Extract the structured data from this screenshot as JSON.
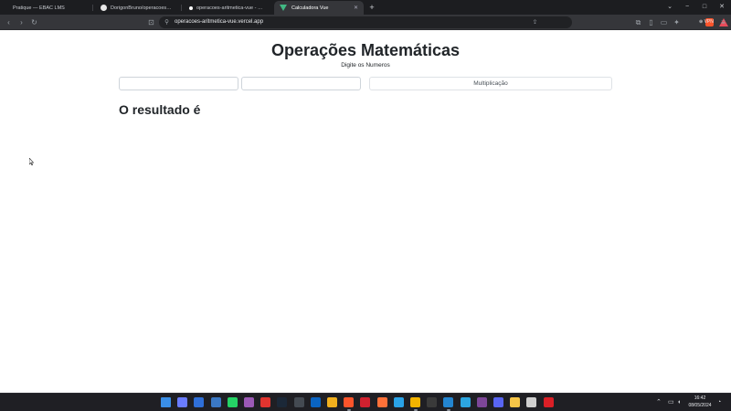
{
  "browser": {
    "tabs": [
      {
        "label": "Pratique — EBAC LMS",
        "icon": "ebac-favicon-icon"
      },
      {
        "label": "DorigonBruno/operacoes_aritmetica",
        "icon": "github-icon"
      },
      {
        "label": "operacoes-aritmetica-vue - Overview",
        "icon": "vercel-icon"
      },
      {
        "label": "Calculadora Vue",
        "icon": "vue-icon",
        "active": true
      }
    ],
    "new_tab": "+",
    "controls": {
      "minimize": "−",
      "maximize": "□",
      "close": "✕",
      "tab_list": "⌄"
    },
    "nav": {
      "back": "‹",
      "forward": "›",
      "reload": "↻",
      "bookmark": "⊡"
    },
    "url": "operacoes-aritmetica-vue.vercel.app",
    "vpn_label": "⊕ VPN"
  },
  "page": {
    "title": "Operações Matemáticas",
    "subtitle": "Digite os Numeros",
    "input1_value": "",
    "input2_value": "",
    "operation_button": "Multiplicação",
    "result_text": "O resultado é"
  },
  "taskbar": {
    "apps": [
      "windows-start-icon",
      "copilot-icon",
      "mail-icon",
      "store-icon",
      "whatsapp-icon",
      "clipchamp-icon",
      "opera-gx-icon",
      "steam-icon",
      "terminal-icon",
      "outlook-icon",
      "file-explorer-icon",
      "brave-icon",
      "opera-icon",
      "firefox-icon",
      "edge-icon",
      "chrome-icon",
      "epic-games-icon",
      "vscode-icon",
      "telegram-icon",
      "tor-icon",
      "discord-icon",
      "python-icon",
      "github-desktop-icon",
      "adobe-icon"
    ],
    "time": "16:42",
    "date": "08/05/2024"
  },
  "colors": {
    "accent_vue": "#41b883",
    "brave": "#fb542b"
  }
}
